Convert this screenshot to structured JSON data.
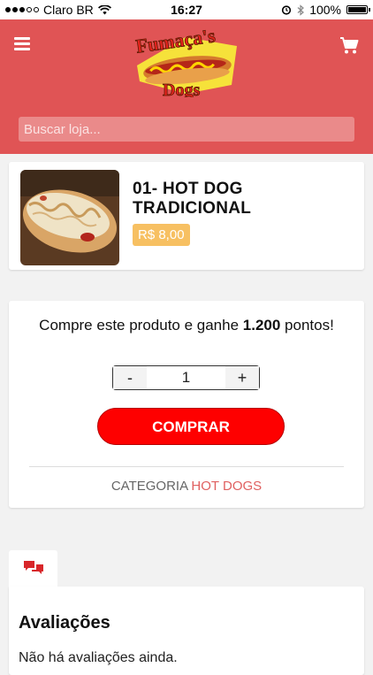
{
  "status_bar": {
    "carrier": "Claro BR",
    "time": "16:27",
    "battery": "100%",
    "battery_level": 1.0
  },
  "header": {
    "logo_text_top": "Fumaça's",
    "logo_text_bottom": "Dogs",
    "search_placeholder": "Buscar loja..."
  },
  "product": {
    "title": "01- HOT DOG TRADICIONAL",
    "price": "R$ 8,00"
  },
  "purchase": {
    "points_prefix": "Compre este produto e ganhe ",
    "points_value": "1.200",
    "points_suffix": " pontos!",
    "quantity_minus": "-",
    "quantity": "1",
    "quantity_plus": "+",
    "buy_label": "COMPRAR",
    "category_label": "CATEGORIA",
    "category_link": "HOT DOGS"
  },
  "reviews": {
    "title": "Avaliações",
    "empty": "Não há avaliações ainda."
  },
  "colors": {
    "header": "#e05455",
    "buy_button": "#fe0000",
    "price_badge": "#f7c062"
  }
}
